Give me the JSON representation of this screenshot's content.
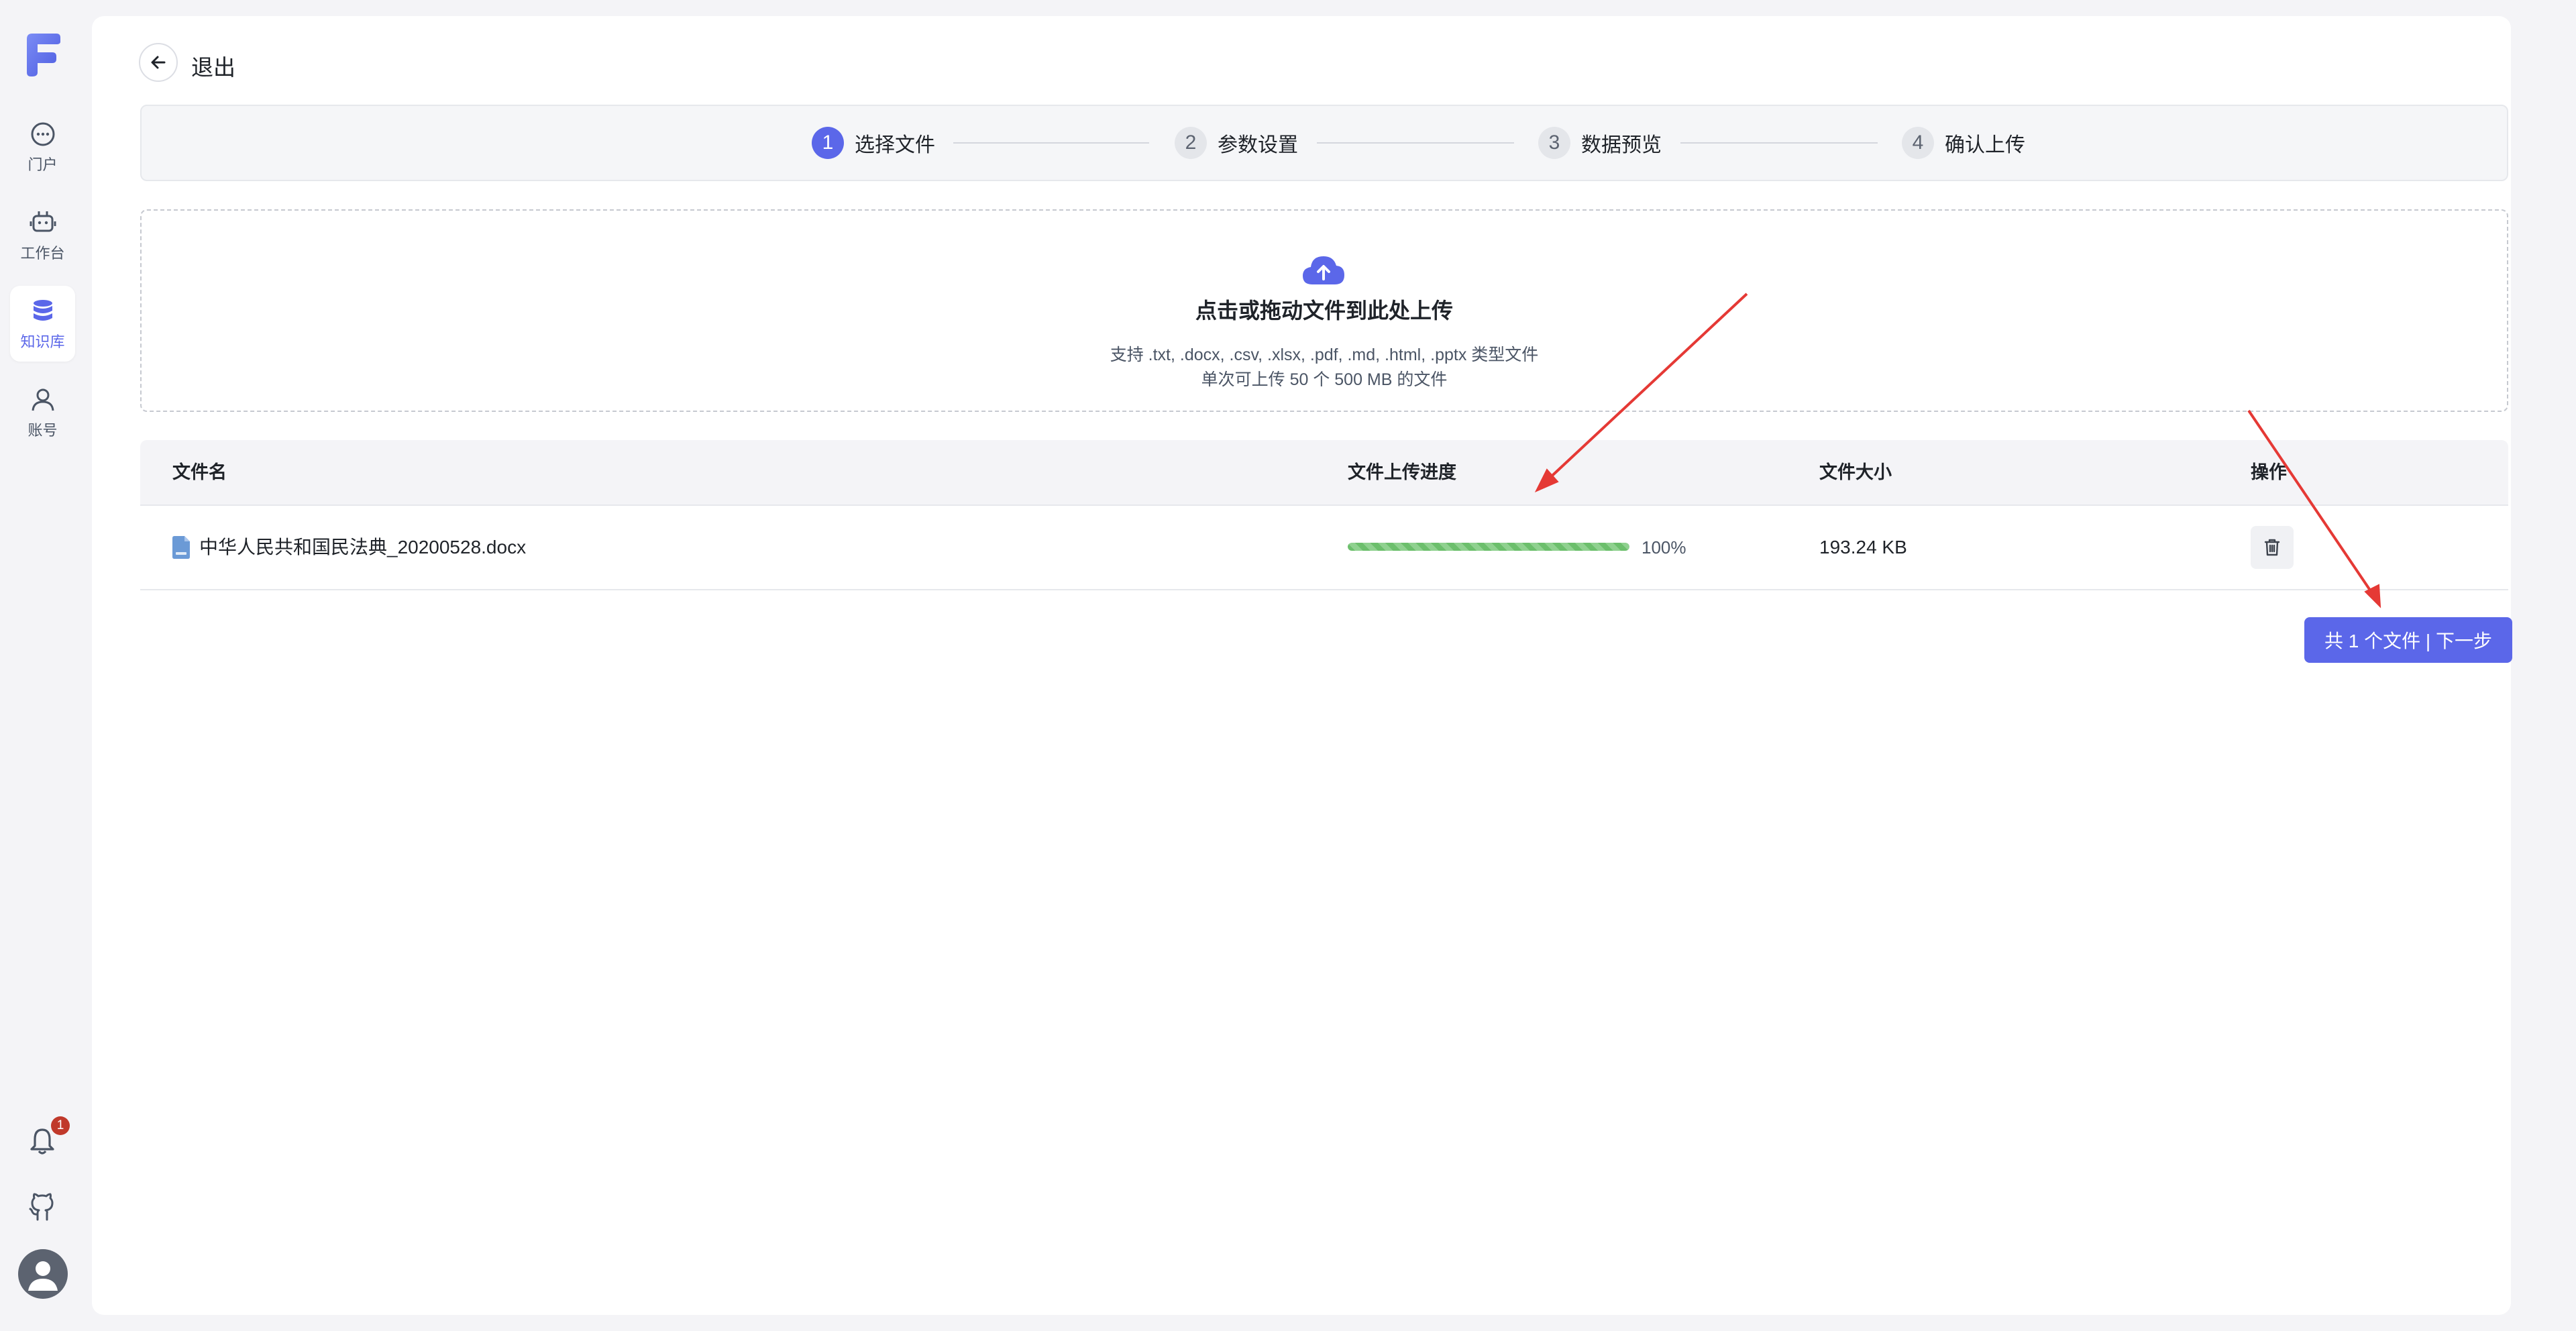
{
  "sidebar": {
    "logo_icon": "brand-logo-icon",
    "items": [
      {
        "label": "门户",
        "icon": "chat-bubble-icon"
      },
      {
        "label": "工作台",
        "icon": "robot-icon"
      },
      {
        "label": "知识库",
        "icon": "database-icon",
        "active": true
      },
      {
        "label": "账号",
        "icon": "user-icon"
      }
    ],
    "notification_count": "1",
    "bottom_icons": [
      "bell-icon",
      "github-icon",
      "avatar"
    ]
  },
  "header": {
    "back_label": "退出"
  },
  "steps": [
    {
      "num": "1",
      "label": "选择文件",
      "active": true
    },
    {
      "num": "2",
      "label": "参数设置"
    },
    {
      "num": "3",
      "label": "数据预览"
    },
    {
      "num": "4",
      "label": "确认上传"
    }
  ],
  "dropzone": {
    "title": "点击或拖动文件到此处上传",
    "supported": "支持 .txt, .docx, .csv, .xlsx, .pdf, .md, .html, .pptx 类型文件",
    "limit": "单次可上传 50 个 500 MB 的文件"
  },
  "table": {
    "columns": [
      "文件名",
      "文件上传进度",
      "文件大小",
      "操作"
    ],
    "rows": [
      {
        "name": "中华人民共和国民法典_20200528.docx",
        "progress": 100,
        "progress_label": "100%",
        "size": "193.24 KB"
      }
    ]
  },
  "next_button": "共 1 个文件 | 下一步",
  "colors": {
    "accent": "#5b67e9",
    "progress": "#6cbf6c",
    "annotation_arrow": "#e53935"
  }
}
